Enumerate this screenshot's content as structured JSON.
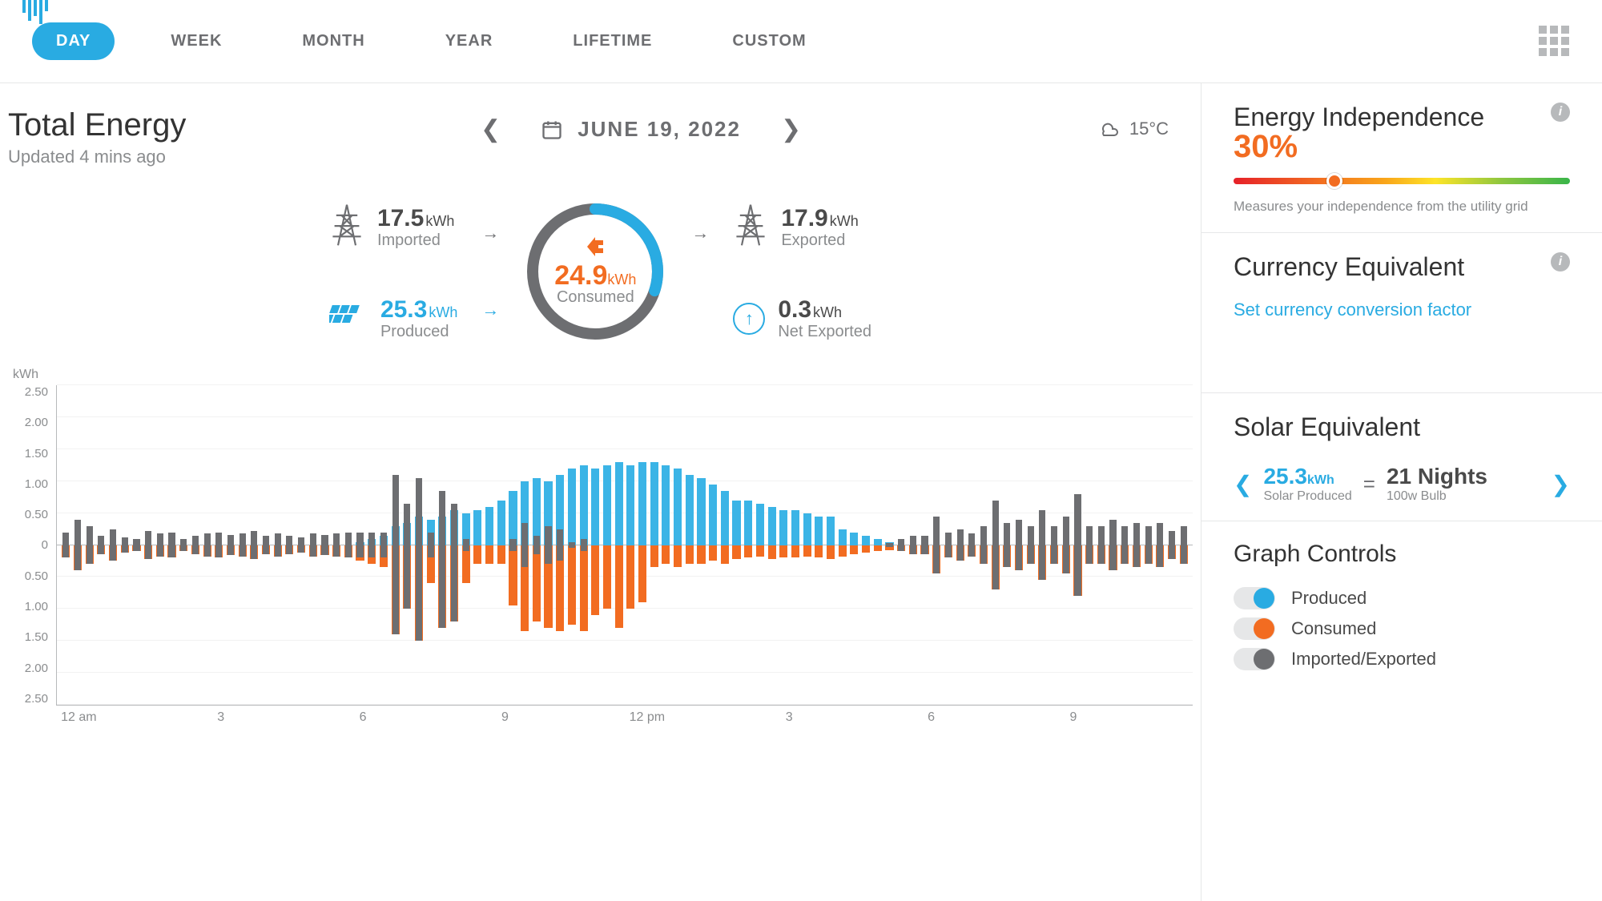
{
  "tabs": {
    "items": [
      "DAY",
      "WEEK",
      "MONTH",
      "YEAR",
      "LIFETIME",
      "CUSTOM"
    ],
    "active": 0
  },
  "title": "Total Energy",
  "updated": "Updated 4 mins ago",
  "date": "JUNE 19, 2022",
  "weather": {
    "temp": "15°C"
  },
  "stats": {
    "imported": {
      "value": "17.5",
      "unit": "kWh",
      "label": "Imported"
    },
    "produced": {
      "value": "25.3",
      "unit": "kWh",
      "label": "Produced"
    },
    "consumed": {
      "value": "24.9",
      "unit": "kWh",
      "label": "Consumed"
    },
    "exported": {
      "value": "17.9",
      "unit": "kWh",
      "label": "Exported"
    },
    "net_exported": {
      "value": "0.3",
      "unit": "kWh",
      "label": "Net Exported"
    }
  },
  "independence": {
    "title": "Energy Independence",
    "percent": "30%",
    "percent_num": 30,
    "subtitle": "Measures your independence from the utility grid"
  },
  "currency": {
    "title": "Currency Equivalent",
    "link": "Set currency conversion factor"
  },
  "solar_eq": {
    "title": "Solar Equivalent",
    "left": {
      "value": "25.3",
      "unit": "kWh",
      "label": "Solar Produced"
    },
    "right": {
      "value": "21 Nights",
      "label": "100w Bulb"
    }
  },
  "controls": {
    "title": "Graph Controls",
    "items": [
      {
        "label": "Produced",
        "color": "blue",
        "on": true
      },
      {
        "label": "Consumed",
        "color": "orange",
        "on": true
      },
      {
        "label": "Imported/Exported",
        "color": "gray",
        "on": true
      }
    ]
  },
  "chart_data": {
    "type": "bar",
    "unit_label": "kWh",
    "ylim": [
      -2.5,
      2.5
    ],
    "y_ticks": [
      "2.50",
      "2.00",
      "1.50",
      "1.00",
      "0.50",
      "0",
      "0.50",
      "1.00",
      "1.50",
      "2.00",
      "2.50"
    ],
    "x_ticks": [
      "12 am",
      "3",
      "6",
      "9",
      "12 pm",
      "3",
      "6",
      "9"
    ],
    "series": [
      {
        "name": "Produced",
        "color": "#3bb4e6"
      },
      {
        "name": "Consumed",
        "color": "#f26c21"
      },
      {
        "name": "Imported/Exported",
        "color": "#6d6e71"
      }
    ],
    "bars": [
      {
        "produced": 0,
        "consumed": 0.2,
        "imp": 0.2
      },
      {
        "produced": 0,
        "consumed": 0.4,
        "imp": 0.4
      },
      {
        "produced": 0,
        "consumed": 0.3,
        "imp": 0.3
      },
      {
        "produced": 0,
        "consumed": 0.15,
        "imp": 0.15
      },
      {
        "produced": 0,
        "consumed": 0.25,
        "imp": 0.25
      },
      {
        "produced": 0,
        "consumed": 0.12,
        "imp": 0.12
      },
      {
        "produced": 0,
        "consumed": 0.1,
        "imp": 0.1
      },
      {
        "produced": 0,
        "consumed": 0.22,
        "imp": 0.22
      },
      {
        "produced": 0,
        "consumed": 0.18,
        "imp": 0.18
      },
      {
        "produced": 0,
        "consumed": 0.2,
        "imp": 0.2
      },
      {
        "produced": 0,
        "consumed": 0.1,
        "imp": 0.1
      },
      {
        "produced": 0,
        "consumed": 0.15,
        "imp": 0.15
      },
      {
        "produced": 0,
        "consumed": 0.18,
        "imp": 0.18
      },
      {
        "produced": 0,
        "consumed": 0.2,
        "imp": 0.2
      },
      {
        "produced": 0,
        "consumed": 0.16,
        "imp": 0.16
      },
      {
        "produced": 0,
        "consumed": 0.18,
        "imp": 0.18
      },
      {
        "produced": 0,
        "consumed": 0.22,
        "imp": 0.22
      },
      {
        "produced": 0,
        "consumed": 0.14,
        "imp": 0.14
      },
      {
        "produced": 0,
        "consumed": 0.18,
        "imp": 0.18
      },
      {
        "produced": 0,
        "consumed": 0.15,
        "imp": 0.15
      },
      {
        "produced": 0,
        "consumed": 0.12,
        "imp": 0.12
      },
      {
        "produced": 0,
        "consumed": 0.18,
        "imp": 0.18
      },
      {
        "produced": 0,
        "consumed": 0.16,
        "imp": 0.16
      },
      {
        "produced": 0,
        "consumed": 0.18,
        "imp": 0.18
      },
      {
        "produced": 0,
        "consumed": 0.2,
        "imp": 0.2
      },
      {
        "produced": 0.05,
        "consumed": 0.25,
        "imp": 0.2
      },
      {
        "produced": 0.1,
        "consumed": 0.3,
        "imp": 0.2
      },
      {
        "produced": 0.15,
        "consumed": 0.35,
        "imp": 0.2
      },
      {
        "produced": 0.3,
        "consumed": 1.4,
        "imp": 1.1
      },
      {
        "produced": 0.35,
        "consumed": 1.0,
        "imp": 0.65
      },
      {
        "produced": 0.45,
        "consumed": 1.5,
        "imp": 1.05
      },
      {
        "produced": 0.4,
        "consumed": 0.6,
        "imp": 0.2
      },
      {
        "produced": 0.45,
        "consumed": 1.3,
        "imp": 0.85
      },
      {
        "produced": 0.55,
        "consumed": 1.2,
        "imp": 0.65
      },
      {
        "produced": 0.5,
        "consumed": 0.6,
        "imp": 0.1
      },
      {
        "produced": 0.55,
        "consumed": 0.3,
        "imp": -0.25
      },
      {
        "produced": 0.6,
        "consumed": 0.3,
        "imp": -0.3
      },
      {
        "produced": 0.7,
        "consumed": 0.3,
        "imp": -0.4
      },
      {
        "produced": 0.85,
        "consumed": 0.95,
        "imp": 0.1
      },
      {
        "produced": 1.0,
        "consumed": 1.35,
        "imp": 0.35
      },
      {
        "produced": 1.05,
        "consumed": 1.2,
        "imp": 0.15
      },
      {
        "produced": 1.0,
        "consumed": 1.3,
        "imp": 0.3
      },
      {
        "produced": 1.1,
        "consumed": 1.35,
        "imp": 0.25
      },
      {
        "produced": 1.2,
        "consumed": 1.25,
        "imp": 0.05
      },
      {
        "produced": 1.25,
        "consumed": 1.35,
        "imp": 0.1
      },
      {
        "produced": 1.2,
        "consumed": 1.1,
        "imp": -0.1
      },
      {
        "produced": 1.25,
        "consumed": 1.0,
        "imp": -0.25
      },
      {
        "produced": 1.3,
        "consumed": 1.3,
        "imp": 0.0
      },
      {
        "produced": 1.25,
        "consumed": 1.0,
        "imp": -0.25
      },
      {
        "produced": 1.3,
        "consumed": 0.9,
        "imp": -0.4
      },
      {
        "produced": 1.3,
        "consumed": 0.35,
        "imp": -0.95
      },
      {
        "produced": 1.25,
        "consumed": 0.3,
        "imp": -0.95
      },
      {
        "produced": 1.2,
        "consumed": 0.35,
        "imp": -0.85
      },
      {
        "produced": 1.1,
        "consumed": 0.3,
        "imp": -0.8
      },
      {
        "produced": 1.05,
        "consumed": 0.3,
        "imp": -0.75
      },
      {
        "produced": 0.95,
        "consumed": 0.25,
        "imp": -0.7
      },
      {
        "produced": 0.85,
        "consumed": 0.3,
        "imp": -0.55
      },
      {
        "produced": 0.7,
        "consumed": 0.22,
        "imp": -0.48
      },
      {
        "produced": 0.7,
        "consumed": 0.2,
        "imp": -0.5
      },
      {
        "produced": 0.65,
        "consumed": 0.18,
        "imp": -0.47
      },
      {
        "produced": 0.6,
        "consumed": 0.22,
        "imp": -0.38
      },
      {
        "produced": 0.55,
        "consumed": 0.2,
        "imp": -0.35
      },
      {
        "produced": 0.55,
        "consumed": 0.2,
        "imp": -0.35
      },
      {
        "produced": 0.5,
        "consumed": 0.18,
        "imp": -0.32
      },
      {
        "produced": 0.45,
        "consumed": 0.2,
        "imp": -0.25
      },
      {
        "produced": 0.45,
        "consumed": 0.22,
        "imp": -0.23
      },
      {
        "produced": 0.25,
        "consumed": 0.18,
        "imp": -0.07
      },
      {
        "produced": 0.2,
        "consumed": 0.15,
        "imp": -0.05
      },
      {
        "produced": 0.15,
        "consumed": 0.12,
        "imp": -0.03
      },
      {
        "produced": 0.1,
        "consumed": 0.1,
        "imp": 0.0
      },
      {
        "produced": 0.05,
        "consumed": 0.08,
        "imp": 0.03
      },
      {
        "produced": 0,
        "consumed": 0.1,
        "imp": 0.1
      },
      {
        "produced": 0,
        "consumed": 0.15,
        "imp": 0.15
      },
      {
        "produced": 0,
        "consumed": 0.15,
        "imp": 0.15
      },
      {
        "produced": 0,
        "consumed": 0.45,
        "imp": 0.45
      },
      {
        "produced": 0,
        "consumed": 0.2,
        "imp": 0.2
      },
      {
        "produced": 0,
        "consumed": 0.25,
        "imp": 0.25
      },
      {
        "produced": 0,
        "consumed": 0.18,
        "imp": 0.18
      },
      {
        "produced": 0,
        "consumed": 0.3,
        "imp": 0.3
      },
      {
        "produced": 0,
        "consumed": 0.7,
        "imp": 0.7
      },
      {
        "produced": 0,
        "consumed": 0.35,
        "imp": 0.35
      },
      {
        "produced": 0,
        "consumed": 0.4,
        "imp": 0.4
      },
      {
        "produced": 0,
        "consumed": 0.3,
        "imp": 0.3
      },
      {
        "produced": 0,
        "consumed": 0.55,
        "imp": 0.55
      },
      {
        "produced": 0,
        "consumed": 0.3,
        "imp": 0.3
      },
      {
        "produced": 0,
        "consumed": 0.45,
        "imp": 0.45
      },
      {
        "produced": 0,
        "consumed": 0.8,
        "imp": 0.8
      },
      {
        "produced": 0,
        "consumed": 0.3,
        "imp": 0.3
      },
      {
        "produced": 0,
        "consumed": 0.3,
        "imp": 0.3
      },
      {
        "produced": 0,
        "consumed": 0.4,
        "imp": 0.4
      },
      {
        "produced": 0,
        "consumed": 0.3,
        "imp": 0.3
      },
      {
        "produced": 0,
        "consumed": 0.35,
        "imp": 0.35
      },
      {
        "produced": 0,
        "consumed": 0.3,
        "imp": 0.3
      },
      {
        "produced": 0,
        "consumed": 0.35,
        "imp": 0.35
      },
      {
        "produced": 0,
        "consumed": 0.22,
        "imp": 0.22
      },
      {
        "produced": 0,
        "consumed": 0.3,
        "imp": 0.3
      }
    ]
  }
}
